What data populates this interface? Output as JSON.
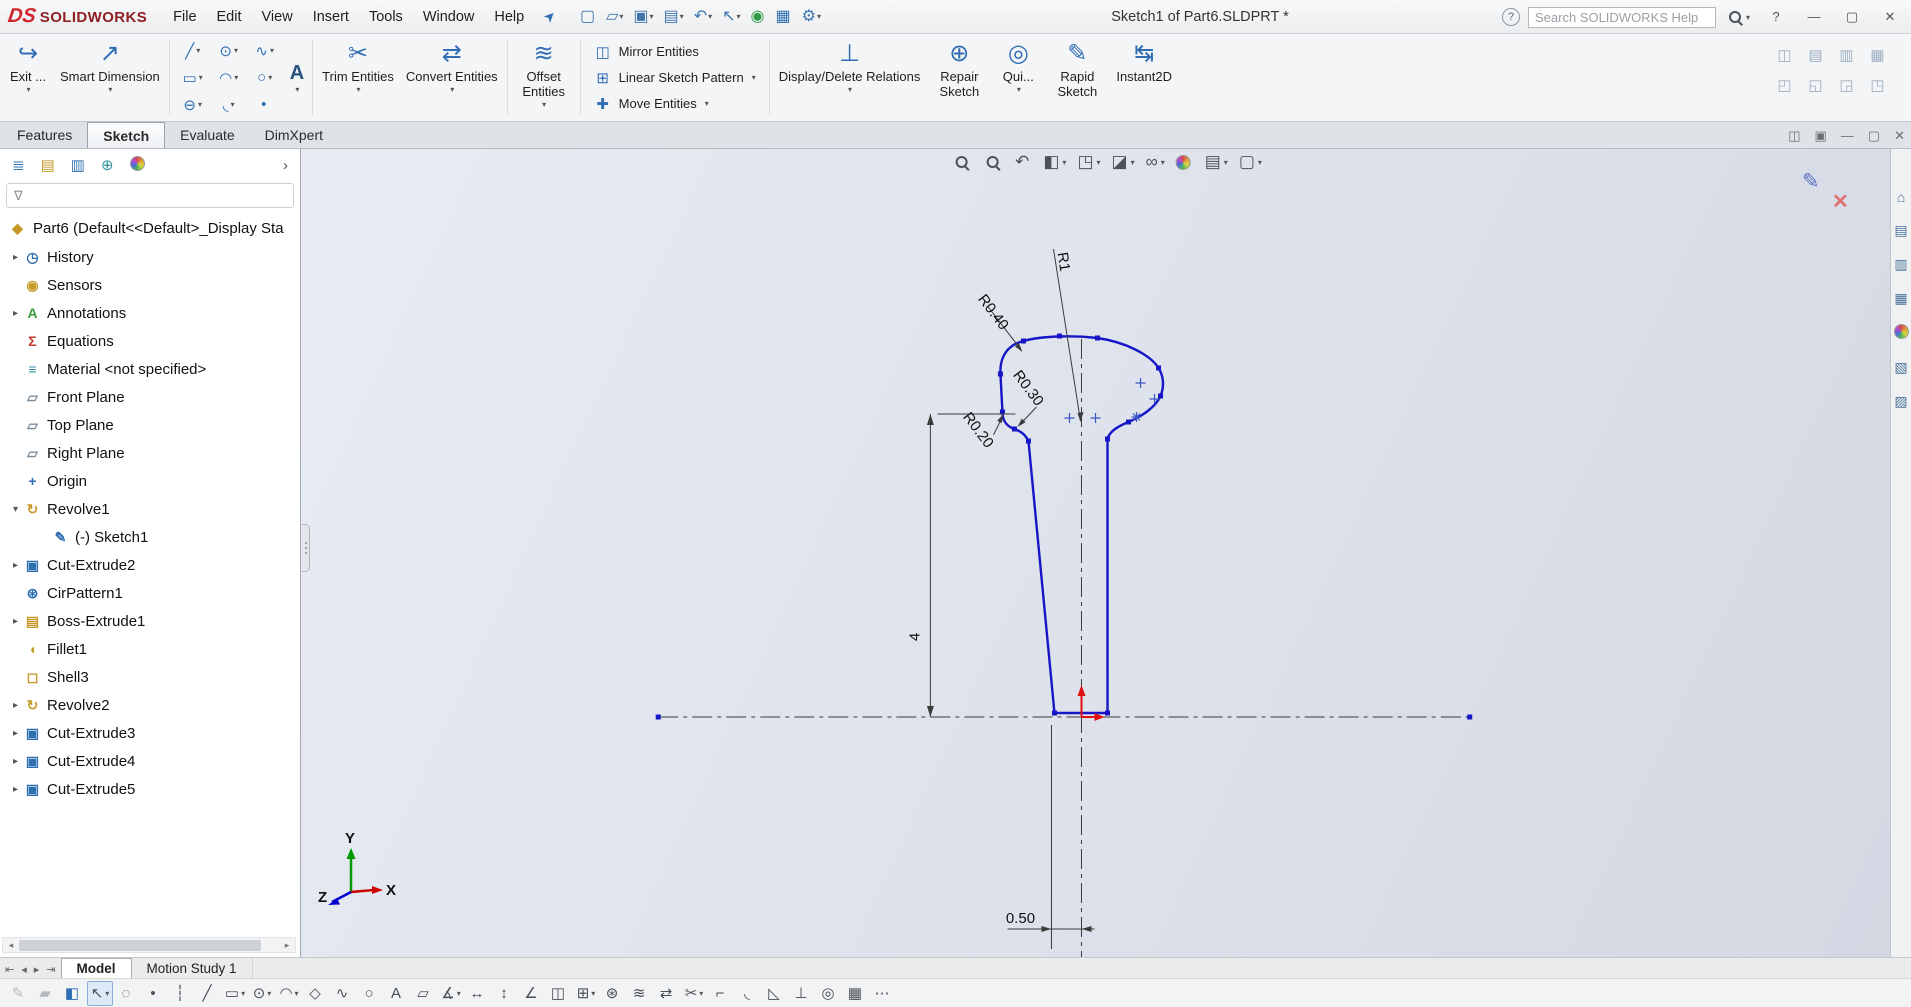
{
  "window": {
    "logo_ds": "DS",
    "logo_text": "SOLIDWORKS",
    "menus": [
      "File",
      "Edit",
      "View",
      "Insert",
      "Tools",
      "Window",
      "Help"
    ],
    "title": "Sketch1 of Part6.SLDPRT *",
    "search_placeholder": "Search SOLIDWORKS Help",
    "help_q": "?",
    "minimize": "—",
    "maximize": "▢",
    "close": "✕"
  },
  "icons": {
    "chevron": "▾",
    "pin": "➤",
    "part": "◆",
    "funnel": "∇",
    "panel_flyout": "›",
    "help_circle": "?",
    "exit_sketch": "↪",
    "smart_dimension": "↗",
    "trim": "✂",
    "convert": "⇄",
    "offset": "≋",
    "mirror": "◫",
    "linear_pattern": "⊞",
    "move": "✚",
    "display_delete": "⊥",
    "repair": "⊕",
    "quick_snaps": "◎",
    "rapid": "✎",
    "instant2d": "↹"
  },
  "quick_toolbar": [
    {
      "name": "new-document-icon",
      "glyph": "▢",
      "dd": ""
    },
    {
      "name": "open-icon",
      "glyph": "▱",
      "dd": "▾"
    },
    {
      "name": "save-icon",
      "glyph": "▣",
      "dd": "▾"
    },
    {
      "name": "print-icon",
      "glyph": "▤",
      "dd": "▾"
    },
    {
      "name": "undo-icon",
      "glyph": "↶",
      "dd": "▾"
    },
    {
      "name": "select-cursor-icon",
      "glyph": "↖",
      "dd": "▾"
    },
    {
      "name": "selection-filter-icon",
      "glyph": "◉",
      "dd": "",
      "cls": "ic-green"
    },
    {
      "name": "view-grid-icon",
      "glyph": "▦",
      "dd": "",
      "cls": "ic-blue"
    },
    {
      "name": "options-gear-icon",
      "glyph": "⚙",
      "dd": "▾"
    }
  ],
  "ribbon": {
    "exit_label": "Exit ...",
    "smart_dimension": "Smart Dimension",
    "trim": "Trim Entities",
    "convert": "Convert Entities",
    "offset": "Offset Entities",
    "mirror": "Mirror Entities",
    "linear_pattern": "Linear Sketch Pattern",
    "move": "Move Entities",
    "display_delete": "Display/Delete Relations",
    "repair": "Repair Sketch",
    "quick_snaps": "Qui...",
    "rapid": "Rapid Sketch",
    "instant2d": "Instant2D",
    "text_tool": "A",
    "sketch_grid": [
      {
        "name": "line-tool-icon",
        "glyph": "╱",
        "dd": "▾"
      },
      {
        "name": "circle-tool-icon",
        "glyph": "⊙",
        "dd": "▾"
      },
      {
        "name": "spline-tool-icon",
        "glyph": "∿",
        "dd": "▾"
      },
      {
        "name": "rectangle-tool-icon",
        "glyph": "▭",
        "dd": "▾"
      },
      {
        "name": "arc-tool-icon",
        "glyph": "◠",
        "dd": "▾"
      },
      {
        "name": "ellipse-tool-icon",
        "glyph": "○",
        "dd": "▾"
      },
      {
        "name": "slot-tool-icon",
        "glyph": "⊖",
        "dd": "▾"
      },
      {
        "name": "sketch-fillet-tool-icon",
        "glyph": "◟",
        "dd": "▾"
      },
      {
        "name": "point-tool-icon",
        "glyph": "•",
        "dd": ""
      }
    ],
    "right_icons": [
      {
        "name": "collapsed-toolbar-icon-1",
        "glyph": "◫"
      },
      {
        "name": "collapsed-toolbar-icon-2",
        "glyph": "▤"
      },
      {
        "name": "collapsed-toolbar-icon-3",
        "glyph": "▥"
      },
      {
        "name": "collapsed-toolbar-icon-4",
        "glyph": "▦"
      },
      {
        "name": "collapsed-toolbar-icon-5",
        "glyph": "◰"
      },
      {
        "name": "collapsed-toolbar-icon-6",
        "glyph": "◱"
      },
      {
        "name": "collapsed-toolbar-icon-7",
        "glyph": "◲"
      },
      {
        "name": "collapsed-toolbar-icon-8",
        "glyph": "◳"
      }
    ]
  },
  "tabs": [
    {
      "name": "tab-features",
      "label": "Features"
    },
    {
      "name": "tab-sketch",
      "label": "Sketch",
      "cls": "active"
    },
    {
      "name": "tab-evaluate",
      "label": "Evaluate"
    },
    {
      "name": "tab-dimxpert",
      "label": "DimXpert"
    }
  ],
  "doc_window_icons": [
    {
      "name": "new-window-icon",
      "glyph": "◫"
    },
    {
      "name": "cascade-windows-icon",
      "glyph": "▣"
    },
    {
      "name": "minimize-doc-icon",
      "glyph": "—"
    },
    {
      "name": "restore-doc-icon",
      "glyph": "▢"
    },
    {
      "name": "close-doc-icon",
      "glyph": "✕"
    }
  ],
  "headsup": [
    {
      "name": "zoom-to-fit-icon",
      "glyph": "",
      "cls": "g-mag",
      "dd": ""
    },
    {
      "name": "zoom-to-area-icon",
      "glyph": "",
      "cls": "g-mag",
      "dd": ""
    },
    {
      "name": "previous-view-icon",
      "glyph": "↶",
      "dd": ""
    },
    {
      "name": "section-view-icon",
      "glyph": "◧",
      "dd": "▾"
    },
    {
      "name": "view-orientation-icon",
      "glyph": "◳",
      "dd": "▾"
    },
    {
      "name": "display-style-icon",
      "glyph": "◪",
      "dd": "▾"
    },
    {
      "name": "hide-show-items-icon",
      "glyph": "∞",
      "dd": "▾"
    },
    {
      "name": "edit-appearance-icon",
      "glyph": "",
      "cls": "g-ball",
      "dd": ""
    },
    {
      "name": "apply-scene-icon",
      "glyph": "▤",
      "dd": "▾"
    },
    {
      "name": "view-settings-icon",
      "glyph": "▢",
      "dd": "▾"
    }
  ],
  "panel": {
    "tabs": [
      {
        "name": "featuremanager-tab-icon",
        "glyph": "≣",
        "cls": "ic-blue"
      },
      {
        "name": "propertymanager-tab-icon",
        "glyph": "▤",
        "cls": "ic-gold"
      },
      {
        "name": "configurationmanager-tab-icon",
        "glyph": "▥",
        "cls": "ic-blue"
      },
      {
        "name": "dimxpertmanager-tab-icon",
        "glyph": "⊕",
        "cls": "ic-teal"
      },
      {
        "name": "displaymanager-tab-icon",
        "glyph": "",
        "cls": "g-ball"
      }
    ],
    "root": "Part6 (Default<<Default>_Display Sta",
    "tree": [
      {
        "name": "tree-item-history",
        "arrow": "▸",
        "icon": "◷",
        "label": "History",
        "cls": "ic-blue"
      },
      {
        "name": "tree-item-sensors",
        "arrow": "",
        "icon": "◉",
        "label": "Sensors",
        "cls": "ic-gold"
      },
      {
        "name": "tree-item-annotations",
        "arrow": "▸",
        "icon": "A",
        "label": "Annotations",
        "cls": "ic-green"
      },
      {
        "name": "tree-item-equations",
        "arrow": "",
        "icon": "Σ",
        "label": "Equations",
        "cls": "ic-red"
      },
      {
        "name": "tree-item-material",
        "arrow": "",
        "icon": "≡",
        "label": "Material <not specified>",
        "cls": "ic-teal"
      },
      {
        "name": "tree-item-front-plane",
        "arrow": "",
        "icon": "▱",
        "label": "Front Plane",
        "cls": "ic-nav"
      },
      {
        "name": "tree-item-top-plane",
        "arrow": "",
        "icon": "▱",
        "label": "Top Plane",
        "cls": "ic-nav"
      },
      {
        "name": "tree-item-right-plane",
        "arrow": "",
        "icon": "▱",
        "label": "Right Plane",
        "cls": "ic-nav"
      },
      {
        "name": "tree-item-origin",
        "arrow": "",
        "icon": "+",
        "label": "Origin",
        "cls": "ic-blue"
      },
      {
        "name": "tree-item-revolve1",
        "arrow": "▾",
        "icon": "↻",
        "label": "Revolve1",
        "cls": "ic-gold"
      },
      {
        "name": "tree-item-sketch1",
        "arrow": "",
        "icon": "✎",
        "label": "(-) Sketch1",
        "cls": "ic-blue ind1"
      },
      {
        "name": "tree-item-cut-extrude2",
        "arrow": "▸",
        "icon": "▣",
        "label": "Cut-Extrude2",
        "cls": "ic-blue"
      },
      {
        "name": "tree-item-cirpattern1",
        "arrow": "",
        "icon": "⊛",
        "label": "CirPattern1",
        "cls": "ic-blue"
      },
      {
        "name": "tree-item-boss-extrude1",
        "arrow": "▸",
        "icon": "▤",
        "label": "Boss-Extrude1",
        "cls": "ic-gold"
      },
      {
        "name": "tree-item-fillet1",
        "arrow": "",
        "icon": "◖",
        "label": "Fillet1",
        "cls": "ic-gold"
      },
      {
        "name": "tree-item-shell3",
        "arrow": "",
        "icon": "◻",
        "label": "Shell3",
        "cls": "ic-gold"
      },
      {
        "name": "tree-item-revolve2",
        "arrow": "▸",
        "icon": "↻",
        "label": "Revolve2",
        "cls": "ic-gold"
      },
      {
        "name": "tree-item-cut-extrude3",
        "arrow": "▸",
        "icon": "▣",
        "label": "Cut-Extrude3",
        "cls": "ic-blue"
      },
      {
        "name": "tree-item-cut-extrude4",
        "arrow": "▸",
        "icon": "▣",
        "label": "Cut-Extrude4",
        "cls": "ic-blue"
      },
      {
        "name": "tree-item-cut-extrude5",
        "arrow": "▸",
        "icon": "▣",
        "label": "Cut-Extrude5",
        "cls": "ic-blue"
      }
    ]
  },
  "viewport": {
    "dims": {
      "r1": "R1",
      "r040": "R0.40",
      "r020": "R0.20",
      "r030": "R0.30",
      "height": "4",
      "radius": "0.50"
    },
    "triad": {
      "x": "X",
      "y": "Y",
      "z": "Z"
    }
  },
  "right_panel": [
    {
      "name": "home-icon",
      "glyph": "⌂"
    },
    {
      "name": "design-library-icon",
      "glyph": "▤"
    },
    {
      "name": "file-explorer-icon",
      "glyph": "▥"
    },
    {
      "name": "view-palette-icon",
      "glyph": "▦"
    },
    {
      "name": "appearances-icon",
      "glyph": "",
      "cls": "g-ball"
    },
    {
      "name": "scenes-icon",
      "glyph": "▧"
    },
    {
      "name": "custom-properties-icon",
      "glyph": "▨"
    }
  ],
  "bottom": {
    "nav": [
      {
        "name": "first-tab-icon",
        "glyph": "⇤"
      },
      {
        "name": "prev-tab-icon",
        "glyph": "◂"
      },
      {
        "name": "next-tab-icon",
        "glyph": "▸"
      },
      {
        "name": "last-tab-icon",
        "glyph": "⇥"
      }
    ],
    "tabs": [
      {
        "name": "tab-model",
        "label": "Model",
        "cls": "active"
      },
      {
        "name": "tab-motion-study-1",
        "label": "Motion Study 1"
      }
    ],
    "toolbar": [
      {
        "name": "markup-pen-icon",
        "glyph": "✎",
        "dd": "",
        "cls": "disabled"
      },
      {
        "name": "markup-highlight-icon",
        "glyph": "▰",
        "dd": "",
        "cls": "disabled"
      },
      {
        "name": "color-display-icon",
        "glyph": "◧",
        "dd": "",
        "cls": "ic-blue"
      },
      {
        "name": "select-arrow-icon",
        "glyph": "↖",
        "dd": "▾",
        "cls": "pressed"
      },
      {
        "name": "lasso-select-icon",
        "glyph": "◌",
        "dd": ""
      },
      {
        "name": "point-icon",
        "glyph": "•",
        "dd": ""
      },
      {
        "name": "centerline-icon",
        "glyph": "┆",
        "dd": ""
      },
      {
        "name": "line-icon",
        "glyph": "╱",
        "dd": ""
      },
      {
        "name": "rectangle-icon",
        "glyph": "▭",
        "dd": "▾"
      },
      {
        "name": "circle-icon",
        "glyph": "⊙",
        "dd": "▾"
      },
      {
        "name": "arc-icon",
        "glyph": "◠",
        "dd": "▾"
      },
      {
        "name": "polygon-icon",
        "glyph": "◇",
        "dd": ""
      },
      {
        "name": "spline-icon",
        "glyph": "∿",
        "dd": ""
      },
      {
        "name": "ellipse-icon",
        "glyph": "○",
        "dd": ""
      },
      {
        "name": "text-icon",
        "glyph": "A",
        "dd": ""
      },
      {
        "name": "plane-icon",
        "glyph": "▱",
        "dd": ""
      },
      {
        "name": "smart-dimension-icon",
        "glyph": "∡",
        "dd": "▾"
      },
      {
        "name": "horizontal-dimension-icon",
        "glyph": "↔",
        "dd": ""
      },
      {
        "name": "vertical-dimension-icon",
        "glyph": "↕",
        "dd": ""
      },
      {
        "name": "angle-dimension-icon",
        "glyph": "∠",
        "dd": ""
      },
      {
        "name": "mirror-icon",
        "glyph": "◫",
        "dd": ""
      },
      {
        "name": "linear-pattern-icon",
        "glyph": "⊞",
        "dd": "▾"
      },
      {
        "name": "circular-pattern-icon",
        "glyph": "⊛",
        "dd": ""
      },
      {
        "name": "offset-icon",
        "glyph": "≋",
        "dd": ""
      },
      {
        "name": "convert-icon",
        "glyph": "⇄",
        "dd": ""
      },
      {
        "name": "trim-icon",
        "glyph": "✂",
        "dd": "▾"
      },
      {
        "name": "extend-icon",
        "glyph": "⌐",
        "dd": ""
      },
      {
        "name": "fillet-icon",
        "glyph": "◟",
        "dd": ""
      },
      {
        "name": "chamfer-icon",
        "glyph": "◺",
        "dd": ""
      },
      {
        "name": "relations-icon",
        "glyph": "⊥",
        "dd": ""
      },
      {
        "name": "snap-icon",
        "glyph": "◎",
        "dd": ""
      },
      {
        "name": "grid-icon",
        "glyph": "▦",
        "dd": ""
      },
      {
        "name": "more-tools-icon",
        "glyph": "⋯",
        "dd": ""
      }
    ]
  }
}
